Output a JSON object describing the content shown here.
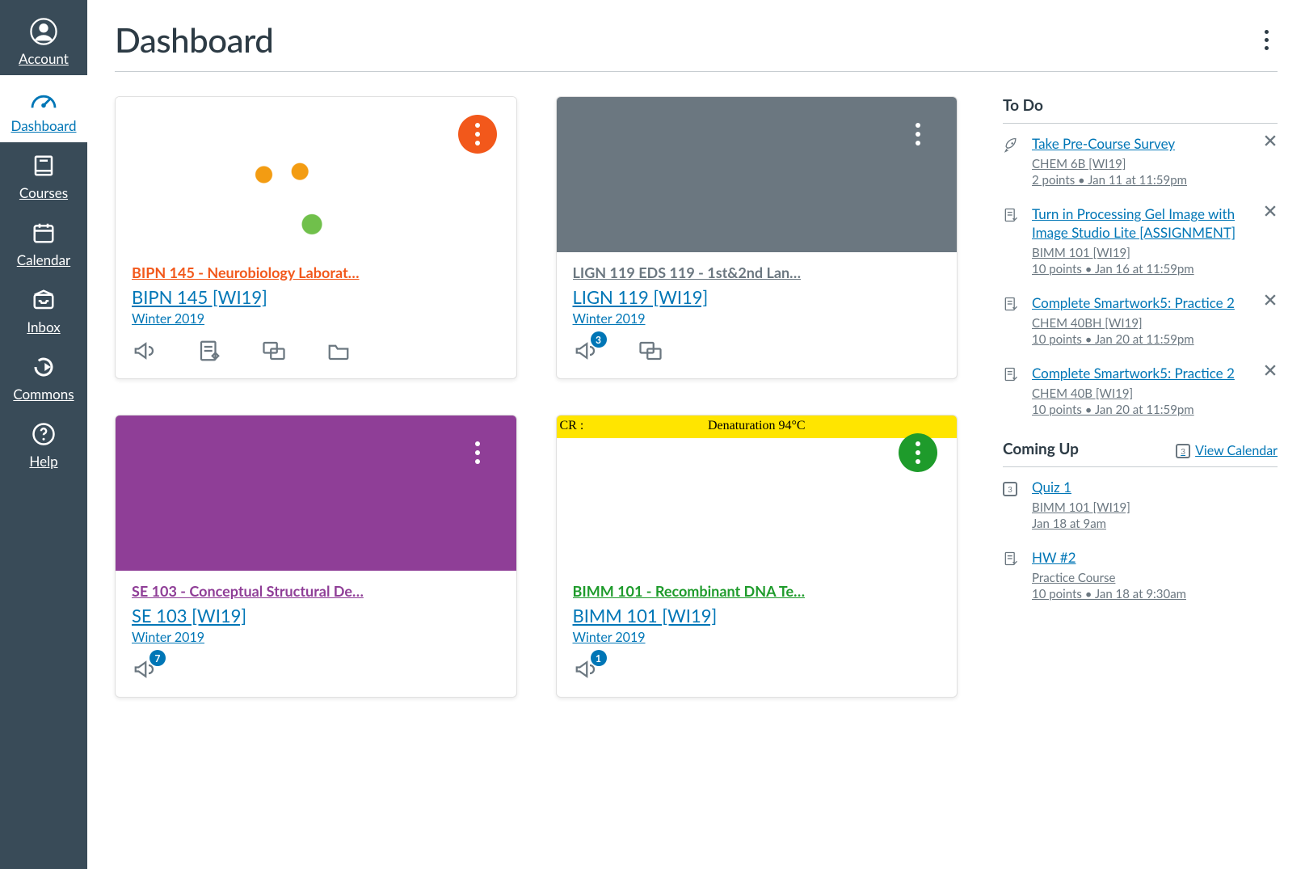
{
  "nav": {
    "items": [
      {
        "id": "account",
        "label": "Account"
      },
      {
        "id": "dashboard",
        "label": "Dashboard"
      },
      {
        "id": "courses",
        "label": "Courses"
      },
      {
        "id": "calendar",
        "label": "Calendar"
      },
      {
        "id": "inbox",
        "label": "Inbox"
      },
      {
        "id": "commons",
        "label": "Commons"
      },
      {
        "id": "help",
        "label": "Help"
      }
    ],
    "active": "dashboard"
  },
  "page": {
    "title": "Dashboard"
  },
  "cards": [
    {
      "accent": "#F2581B",
      "menu_style": "solid",
      "hero_class": "hero-neuro",
      "title": "BIPN 145 - Neurobiology Laborat…",
      "code": "BIPN 145 [WI19]",
      "term": "Winter 2019",
      "actions": [
        "announcements",
        "assignments",
        "discussions",
        "files"
      ],
      "badges": {}
    },
    {
      "accent": "#6B7780",
      "menu_style": "plain",
      "hero_class": "hero-gray",
      "title": "LIGN 119 EDS 119 - 1st&2nd Lan…",
      "code": "LIGN 119 [WI19]",
      "term": "Winter 2019",
      "actions": [
        "announcements",
        "discussions"
      ],
      "badges": {
        "announcements": "3"
      }
    },
    {
      "accent": "#8F3E97",
      "menu_style": "plain",
      "hero_class": "hero-purple",
      "title": "SE 103 - Conceptual Structural De…",
      "code": "SE 103 [WI19]",
      "term": "Winter 2019",
      "actions": [
        "announcements"
      ],
      "badges": {
        "announcements": "7"
      }
    },
    {
      "accent": "#1E9B2B",
      "menu_style": "solid",
      "hero_class": "hero-pcr",
      "title": "BIMM 101 - Recombinant DNA Te…",
      "code": "BIMM 101 [WI19]",
      "term": "Winter 2019",
      "pcr_left": "CR :",
      "pcr_center": "Denaturation 94°C",
      "actions": [
        "announcements"
      ],
      "badges": {
        "announcements": "1"
      }
    }
  ],
  "todo": {
    "heading": "To Do",
    "items": [
      {
        "icon": "rocket",
        "title": "Take Pre-Course Survey",
        "course": "CHEM 6B [WI19]",
        "meta": "2 points • Jan 11 at 11:59pm"
      },
      {
        "icon": "assignment",
        "title": "Turn in Processing Gel Image with Image Studio Lite [ASSIGNMENT]",
        "course": "BIMM 101 [WI19]",
        "meta": "10 points • Jan 16 at 11:59pm"
      },
      {
        "icon": "assignment",
        "title": "Complete Smartwork5: Practice 2",
        "course": "CHEM 40BH [WI19]",
        "meta": "10 points • Jan 20 at 11:59pm"
      },
      {
        "icon": "assignment",
        "title": "Complete Smartwork5: Practice 2",
        "course": "CHEM 40B [WI19]",
        "meta": "10 points • Jan 20 at 11:59pm"
      }
    ]
  },
  "coming": {
    "heading": "Coming Up",
    "view_calendar": "View Calendar",
    "cal_day": "3",
    "items": [
      {
        "icon": "calendar",
        "day": "3",
        "title": "Quiz 1",
        "course": "BIMM 101 [WI19]",
        "meta": "Jan 18 at 9am"
      },
      {
        "icon": "assignment",
        "title": "HW #2",
        "course": "Practice Course",
        "meta": "10 points • Jan 18 at 9:30am"
      }
    ]
  }
}
